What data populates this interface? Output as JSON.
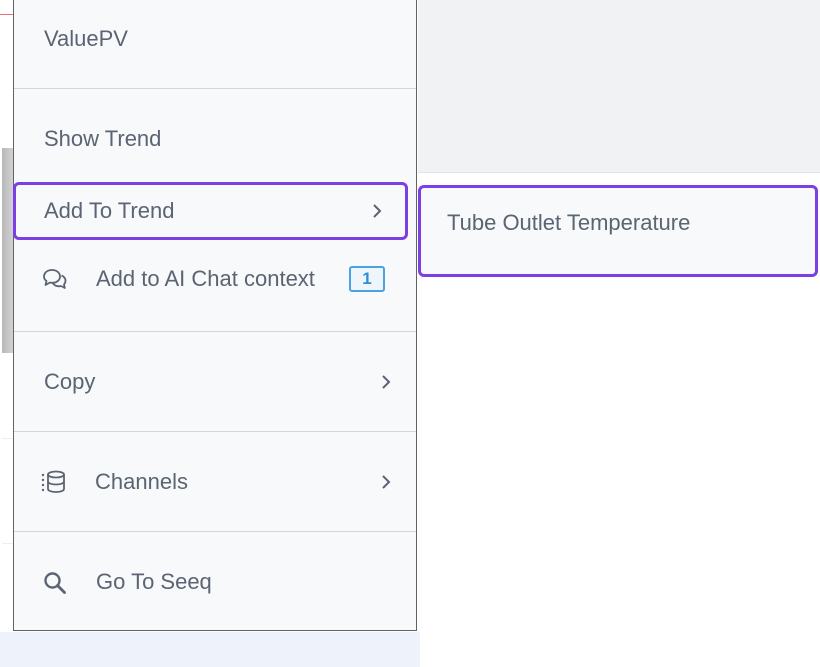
{
  "menu": {
    "header": "ValuePV",
    "items": [
      {
        "id": "show-trend",
        "label": "Show Trend"
      },
      {
        "id": "add-to-trend",
        "label": "Add To Trend",
        "icon": "chevron-right-icon"
      },
      {
        "id": "add-ai-chat",
        "label": "Add to AI Chat context",
        "icon": "chat-bubbles-icon",
        "badge": "1"
      },
      {
        "id": "copy",
        "label": "Copy",
        "icon": "chevron-right-icon"
      },
      {
        "id": "channels",
        "label": "Channels",
        "icon": "database-list-icon"
      },
      {
        "id": "go-to-seeq",
        "label": "Go To Seeq",
        "icon": "search-icon"
      }
    ]
  },
  "submenu": {
    "items": [
      {
        "label": "Tube Outlet Temperature"
      }
    ]
  },
  "colors": {
    "highlight": "#7b3fe4",
    "badge": "#2d8fd5",
    "text": "#5b6473"
  }
}
